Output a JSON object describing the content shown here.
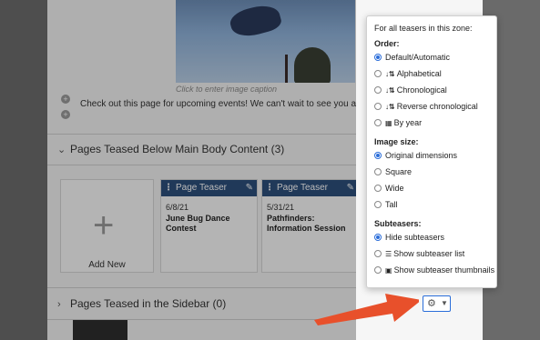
{
  "editor": {
    "image_caption": "Click to enter image caption",
    "body_text": "Check out this page for upcoming events! We can't wait to see you at the parks!",
    "section_below": "Pages Teased Below Main Body Content (3)",
    "section_sidebar": "Pages Teased in the Sidebar (0)",
    "add_new": "Add New",
    "teasers": [
      {
        "title": "Page Teaser",
        "date": "6/8/21",
        "name": "June Bug Dance Contest"
      },
      {
        "title": "Page Teaser",
        "date": "5/31/21",
        "name": "Pathfinders: Information Session"
      }
    ]
  },
  "popover": {
    "intro": "For all teasers in this zone:",
    "order_label": "Order:",
    "order_options": [
      "Default/Automatic",
      "Alphabetical",
      "Chronological",
      "Reverse chronological",
      "By year"
    ],
    "order_selected": "Default/Automatic",
    "size_label": "Image size:",
    "size_options": [
      "Original dimensions",
      "Square",
      "Wide",
      "Tall"
    ],
    "size_selected": "Original dimensions",
    "sub_label": "Subteasers:",
    "sub_options": [
      "Hide subteasers",
      "Show subteaser list",
      "Show subteaser thumbnails"
    ],
    "sub_selected": "Hide subteasers"
  },
  "colors": {
    "accent": "#2a6dd9",
    "teaser_bar": "#2d4f7c",
    "arrow": "#e8502b"
  },
  "icons": {
    "gear": "gear-icon",
    "caret": "caret-down-icon",
    "alpha": "sort-alpha-icon",
    "chrono": "sort-numeric-icon",
    "year": "calendar-grid-icon",
    "list": "list-icon",
    "thumbs": "thumbnails-icon"
  }
}
